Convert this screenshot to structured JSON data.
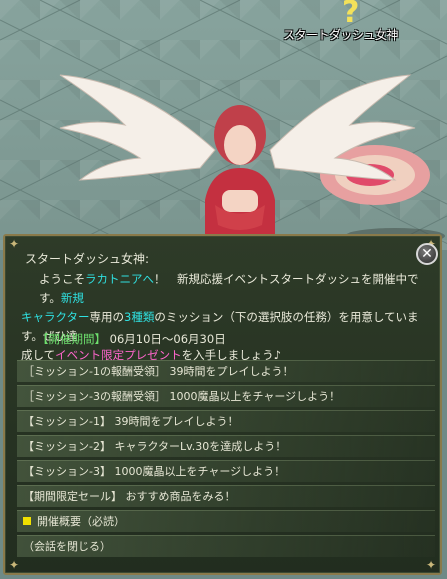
{
  "npc": {
    "name": "スタートダッシュ女神"
  },
  "dialog": {
    "speaker": "スタートダッシュ女神:",
    "message": {
      "l1_a": "ようこそ",
      "l1_b": "ラカトニアへ",
      "l1_c": "！　新規応援イベントスタートダッシュを開催中です。",
      "l1_d": "新規",
      "l2_a": "キャラクター",
      "l2_b": "専用の",
      "l2_c": "3種類",
      "l2_d": "のミッション（下の選択肢の任務）を用意しています。ぜひ達",
      "l3_a": "成して",
      "l3_b": "イベント限定プレゼント",
      "l3_c": "を入手しましょう♪"
    },
    "period": {
      "label": "【開催期間】",
      "value": "06月10日～06月30日"
    },
    "options": [
      "［ミッション-1の報酬受領］ 39時間をプレイしよう！",
      "［ミッション-3の報酬受領］ 1000魔晶以上をチャージしよう！",
      "【ミッション-1】 39時間をプレイしよう！",
      "【ミッション-2】 キャラクターLv.30を達成しよう！",
      "【ミッション-3】 1000魔晶以上をチャージしよう！",
      "【期間限定セール】 おすすめ商品をみる！",
      "開催概要（必読）",
      "（会話を閉じる）"
    ],
    "close_icon": "close-icon"
  },
  "colors": {
    "accent_cyan": "#2fe0e0",
    "accent_pink": "#ff66cc",
    "period_green": "#6ee06e",
    "frame_gold": "#8a7a4a"
  }
}
